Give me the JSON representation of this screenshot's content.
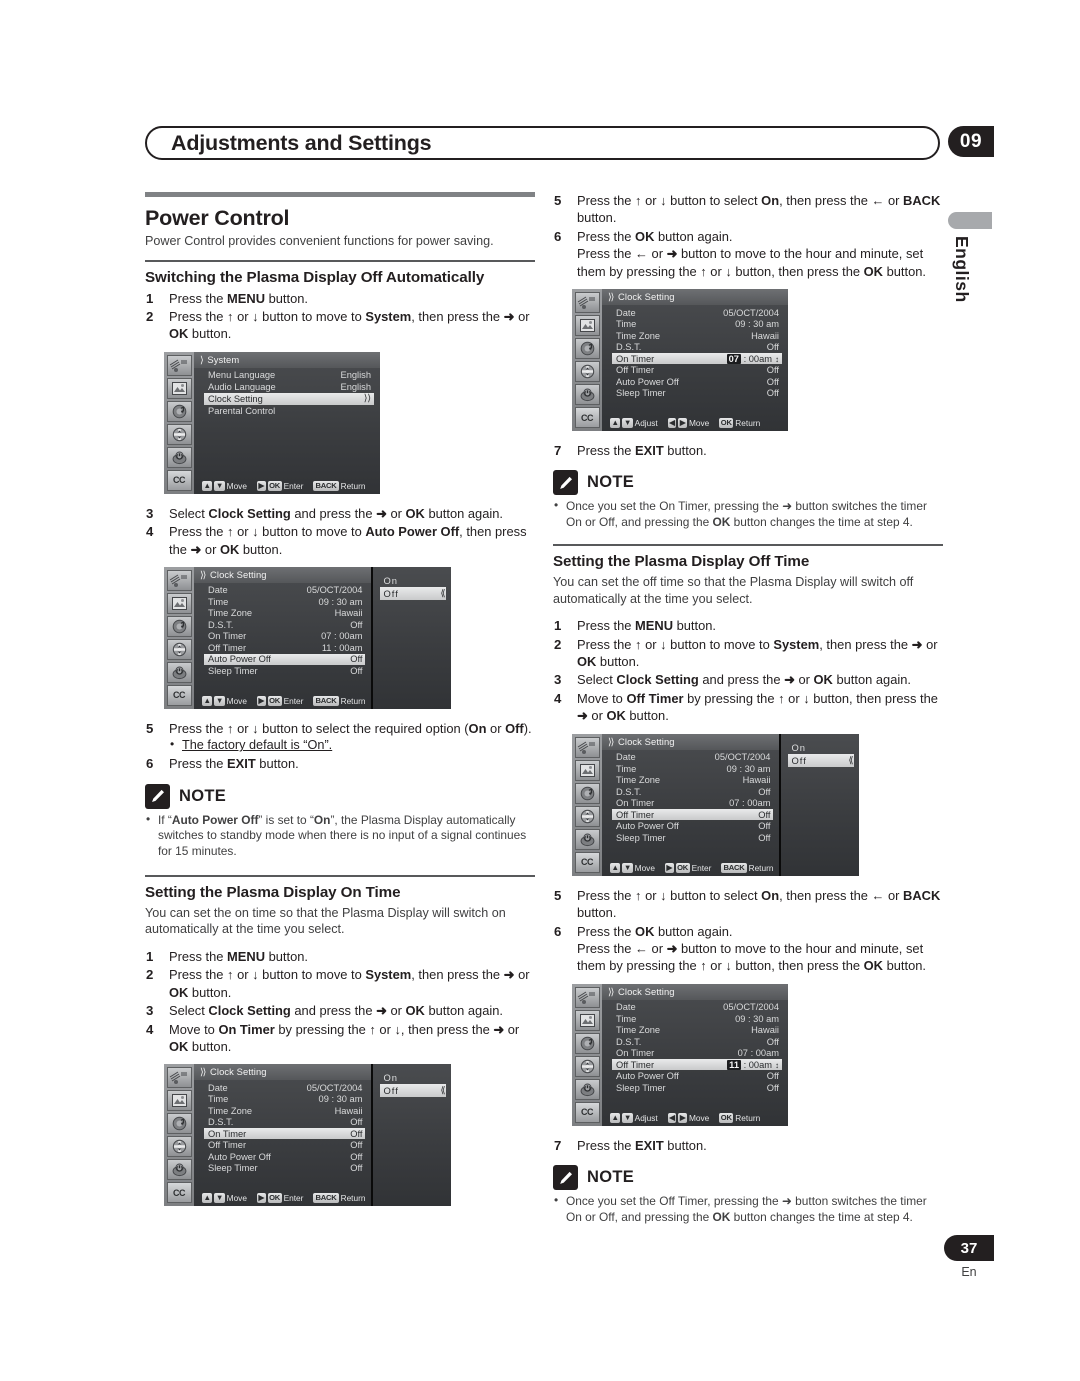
{
  "header": {
    "title": "Adjustments and Settings",
    "chapter": "09"
  },
  "margin": {
    "language": "English"
  },
  "footer": {
    "page_number": "37",
    "language_code": "En"
  },
  "left_column": {
    "section_title": "Power Control",
    "section_lede": "Power Control provides convenient functions for power saving.",
    "sub1": {
      "title": "Switching the Plasma Display Off Automatically",
      "steps": [
        {
          "num": "1",
          "html": "Press the <b>MENU</b> button."
        },
        {
          "num": "2",
          "html": "Press the <b>↑</b> or <b>↓</b> button to move to <b>System</b>, then press the <b>➜</b> or <b>OK</b> button."
        },
        {
          "num": "3",
          "html": "Select <b>Clock Setting</b> and press the <b>➜</b> or <b>OK</b> button again."
        },
        {
          "num": "4",
          "html": "Press the <b>↑</b> or <b>↓</b> button to move to <b>Auto Power Off</b>, then press the <b>➜</b> or <b>OK</b> button."
        },
        {
          "num": "5",
          "html": "Press the <b>↑</b> or <b>↓</b> button to select the required option (<b>On</b> or <b>Off</b>)."
        },
        {
          "num": "6",
          "html": "Press the <b>EXIT</b> button."
        }
      ],
      "step5_subnote": "The factory default is “On”.",
      "note_label": "NOTE",
      "note_html": "If “<b>Auto Power Off</b>” is set to “<b>On</b>”, the Plasma Display automatically switches to standby mode when there is no input of a signal continues for 15 minutes."
    },
    "sub2": {
      "title": "Setting the Plasma Display On Time",
      "lede": "You can set the on time so that the Plasma Display will switch on automatically at the time you select.",
      "steps": [
        {
          "num": "1",
          "html": "Press the <b>MENU</b> button."
        },
        {
          "num": "2",
          "html": "Press the <b>↑</b> or <b>↓</b> button to move to <b>System</b>, then press the <b>➜</b> or <b>OK</b> button."
        },
        {
          "num": "3",
          "html": "Select <b>Clock Setting</b> and press the <b>➜</b> or <b>OK</b> button again."
        },
        {
          "num": "4",
          "html": "Move to <b>On Timer</b> by pressing the <b>↑</b> or <b>↓</b>, then press the <b>➜</b> or <b>OK</b> button."
        }
      ]
    }
  },
  "right_column": {
    "cont_steps": [
      {
        "num": "5",
        "html": "Press the <b>↑</b> or <b>↓</b> button to select <b>On</b>, then press the <b>←</b> or <b>BACK</b> button."
      },
      {
        "num": "6",
        "html": "Press the <b>OK</b> button again.<br>Press the <b>←</b> or <b>➜</b> button to move to the hour and minute, set them by pressing the <b>↑</b> or <b>↓</b> button, then press the <b>OK</b> button."
      }
    ],
    "step7": {
      "num": "7",
      "html": "Press the <b>EXIT</b> button."
    },
    "note1_label": "NOTE",
    "note1_html": "Once you set the On Timer, pressing the ➜ button switches the timer On or Off, and pressing the <b>OK</b> button changes the time at step 4.",
    "sub3": {
      "title": "Setting the Plasma Display Off Time",
      "lede": "You can set the off time so that the Plasma Display will switch off automatically at the time you select.",
      "steps": [
        {
          "num": "1",
          "html": "Press the <b>MENU</b> button."
        },
        {
          "num": "2",
          "html": "Press the <b>↑</b> or <b>↓</b> button to move to <b>System</b>, then press the <b>➜</b> or <b>OK</b> button."
        },
        {
          "num": "3",
          "html": "Select <b>Clock Setting</b> and press the <b>➜</b> or <b>OK</b> button again."
        },
        {
          "num": "4",
          "html": "Move to <b>Off Timer</b> by pressing the <b>↑</b> or <b>↓</b> button, then press the <b>➜</b> or <b>OK</b> button."
        }
      ],
      "cont_steps": [
        {
          "num": "5",
          "html": "Press the <b>↑</b> or <b>↓</b> button to select <b>On</b>, then press the <b>←</b> or <b>BACK</b> button."
        },
        {
          "num": "6",
          "html": "Press the <b>OK</b> button again.<br>Press the <b>←</b> or <b>➜</b> button to move to the hour and minute, set them by pressing the <b>↑</b> or <b>↓</b> button, then press the <b>OK</b> button."
        }
      ],
      "step7": {
        "num": "7",
        "html": "Press the <b>EXIT</b> button."
      },
      "note_label": "NOTE",
      "note_html": "Once you set the Off Timer, pressing the ➜ button switches the timer On or Off, and pressing the <b>OK</b> button changes the time at step 4."
    }
  },
  "osd_screens": [
    {
      "id": "system-menu",
      "title": "System",
      "chevrons": "⟩",
      "rows": [
        {
          "label": "Menu Language",
          "value": "English",
          "selected": false
        },
        {
          "label": "Audio Language",
          "value": "English",
          "selected": false
        },
        {
          "label": "Clock Setting",
          "value": "⟩⟩",
          "selected": true
        },
        {
          "label": "Parental Control",
          "value": "",
          "selected": false
        }
      ],
      "footer": [
        {
          "keys": [
            "▲",
            "▼"
          ],
          "label": "Move"
        },
        {
          "keys": [
            "▶",
            "OK"
          ],
          "label": "Enter"
        },
        {
          "keys": [
            "BACK"
          ],
          "label": "Return"
        }
      ],
      "side_panel": null
    },
    {
      "id": "clock-setting-auto-power-off",
      "title": "Clock Setting",
      "chevrons": "⟩⟩",
      "rows": [
        {
          "label": "Date",
          "value": "05/OCT/2004",
          "selected": false
        },
        {
          "label": "Time",
          "value": "09 : 30 am",
          "selected": false
        },
        {
          "label": "Time Zone",
          "value": "Hawaii",
          "selected": false
        },
        {
          "label": "D.S.T.",
          "value": "Off",
          "selected": false
        },
        {
          "label": "On Timer",
          "value": "07 : 00am",
          "selected": false
        },
        {
          "label": "Off Timer",
          "value": "11 : 00am",
          "selected": false
        },
        {
          "label": "Auto Power Off",
          "value": "Off",
          "selected": true
        },
        {
          "label": "Sleep Timer",
          "value": "Off",
          "selected": false
        }
      ],
      "footer": [
        {
          "keys": [
            "▲",
            "▼"
          ],
          "label": "Move"
        },
        {
          "keys": [
            "▶",
            "OK"
          ],
          "label": "Enter"
        },
        {
          "keys": [
            "BACK"
          ],
          "label": "Return"
        }
      ],
      "side_panel": {
        "options": [
          {
            "label": "On",
            "selected": false
          },
          {
            "label": "Off",
            "selected": true
          }
        ]
      }
    },
    {
      "id": "clock-setting-on-timer",
      "title": "Clock Setting",
      "chevrons": "⟩⟩",
      "rows": [
        {
          "label": "Date",
          "value": "05/OCT/2004",
          "selected": false
        },
        {
          "label": "Time",
          "value": "09 : 30 am",
          "selected": false
        },
        {
          "label": "Time Zone",
          "value": "Hawaii",
          "selected": false
        },
        {
          "label": "D.S.T.",
          "value": "Off",
          "selected": false
        },
        {
          "label": "On Timer",
          "value": "Off",
          "selected": true
        },
        {
          "label": "Off Timer",
          "value": "Off",
          "selected": false
        },
        {
          "label": "Auto Power Off",
          "value": "Off",
          "selected": false
        },
        {
          "label": "Sleep Timer",
          "value": "Off",
          "selected": false
        }
      ],
      "footer": [
        {
          "keys": [
            "▲",
            "▼"
          ],
          "label": "Move"
        },
        {
          "keys": [
            "▶",
            "OK"
          ],
          "label": "Enter"
        },
        {
          "keys": [
            "BACK"
          ],
          "label": "Return"
        }
      ],
      "side_panel": {
        "options": [
          {
            "label": "On",
            "selected": false
          },
          {
            "label": "Off",
            "selected": true
          }
        ]
      }
    },
    {
      "id": "clock-setting-on-timer-hour",
      "title": "Clock Setting",
      "chevrons": "⟩⟩",
      "rows": [
        {
          "label": "Date",
          "value": "05/OCT/2004",
          "selected": false
        },
        {
          "label": "Time",
          "value": "09 : 30 am",
          "selected": false
        },
        {
          "label": "Time Zone",
          "value": "Hawaii",
          "selected": false
        },
        {
          "label": "D.S.T.",
          "value": "Off",
          "selected": false
        },
        {
          "label": "On Timer",
          "value": "07 : 00am",
          "selected": true,
          "hl_prefix": "07",
          "hl_rest": " : 00am",
          "spinner": true
        },
        {
          "label": "Off Timer",
          "value": "Off",
          "selected": false
        },
        {
          "label": "Auto Power Off",
          "value": "Off",
          "selected": false
        },
        {
          "label": "Sleep Timer",
          "value": "Off",
          "selected": false
        }
      ],
      "footer": [
        {
          "keys": [
            "▲",
            "▼"
          ],
          "label": "Adjust"
        },
        {
          "keys": [
            "◀",
            "▶"
          ],
          "label": "Move"
        },
        {
          "keys": [
            "OK"
          ],
          "label": "Return"
        }
      ],
      "side_panel": null
    },
    {
      "id": "clock-setting-off-timer",
      "title": "Clock Setting",
      "chevrons": "⟩⟩",
      "rows": [
        {
          "label": "Date",
          "value": "05/OCT/2004",
          "selected": false
        },
        {
          "label": "Time",
          "value": "09 : 30 am",
          "selected": false
        },
        {
          "label": "Time Zone",
          "value": "Hawaii",
          "selected": false
        },
        {
          "label": "D.S.T.",
          "value": "Off",
          "selected": false
        },
        {
          "label": "On Timer",
          "value": "07 : 00am",
          "selected": false
        },
        {
          "label": "Off Timer",
          "value": "Off",
          "selected": true
        },
        {
          "label": "Auto Power Off",
          "value": "Off",
          "selected": false
        },
        {
          "label": "Sleep Timer",
          "value": "Off",
          "selected": false
        }
      ],
      "footer": [
        {
          "keys": [
            "▲",
            "▼"
          ],
          "label": "Move"
        },
        {
          "keys": [
            "▶",
            "OK"
          ],
          "label": "Enter"
        },
        {
          "keys": [
            "BACK"
          ],
          "label": "Return"
        }
      ],
      "side_panel": {
        "options": [
          {
            "label": "On",
            "selected": false
          },
          {
            "label": "Off",
            "selected": true
          }
        ]
      }
    },
    {
      "id": "clock-setting-off-timer-hour",
      "title": "Clock Setting",
      "chevrons": "⟩⟩",
      "rows": [
        {
          "label": "Date",
          "value": "05/OCT/2004",
          "selected": false
        },
        {
          "label": "Time",
          "value": "09 : 30 am",
          "selected": false
        },
        {
          "label": "Time Zone",
          "value": "Hawaii",
          "selected": false
        },
        {
          "label": "D.S.T.",
          "value": "Off",
          "selected": false
        },
        {
          "label": "On Timer",
          "value": "07 : 00am",
          "selected": false
        },
        {
          "label": "Off Timer",
          "value": "11 : 00am",
          "selected": true,
          "hl_prefix": "11",
          "hl_rest": " : 00am",
          "spinner": true
        },
        {
          "label": "Auto Power Off",
          "value": "Off",
          "selected": false
        },
        {
          "label": "Sleep Timer",
          "value": "Off",
          "selected": false
        }
      ],
      "footer": [
        {
          "keys": [
            "▲",
            "▼"
          ],
          "label": "Adjust"
        },
        {
          "keys": [
            "◀",
            "▶"
          ],
          "label": "Move"
        },
        {
          "keys": [
            "OK"
          ],
          "label": "Return"
        }
      ],
      "side_panel": null
    }
  ],
  "osd_icons": [
    "tuner-icon",
    "picture-icon",
    "audio-icon",
    "screen-icon",
    "power-icon",
    "closed-caption-icon"
  ]
}
